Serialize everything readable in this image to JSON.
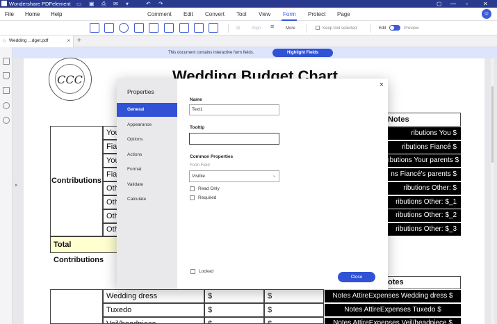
{
  "app": {
    "title": "Wondershare PDFelement"
  },
  "menu": {
    "file": "File",
    "home": "Home",
    "help": "Help",
    "ribbon": [
      "Comment",
      "Edit",
      "Convert",
      "Tool",
      "View",
      "Form",
      "Protect",
      "Page"
    ],
    "active": "Form"
  },
  "toolbar": {
    "align": "Align",
    "more": "More",
    "keep_tool": "Keep tool selected",
    "edit": "Edit",
    "preview": "Preview"
  },
  "tabs": {
    "doc_name": "Wedding ...dget.pdf"
  },
  "notification": {
    "message": "This document contains interactive form fields.",
    "button": "Highlight Fields"
  },
  "document": {
    "title": "Wedding Budget Chart",
    "seal_letters": "CCC",
    "table1": {
      "group_label": "Contributions",
      "notes_header": "Notes",
      "rows": [
        {
          "label": "You",
          "note": "ributions You $"
        },
        {
          "label": "Fianc",
          "note": "ributions Fiancé $"
        },
        {
          "label": "You",
          "note": "ributions Your parents $"
        },
        {
          "label": "Fian",
          "note": "ns Fiancé's parents $"
        },
        {
          "label": "Oth",
          "note": "ributions Other: $"
        },
        {
          "label": "Oth",
          "note": "ributions Other: $_1"
        },
        {
          "label": "Oth",
          "note": "ributions Other: $_2"
        },
        {
          "label": "Oth",
          "note": "ributions Other: $_3"
        }
      ],
      "total_label": "Total Contributions"
    },
    "table2": {
      "notes_header": "otes",
      "rows": [
        {
          "item": "Wedding dress",
          "c1": "$",
          "c2": "$",
          "note": "Notes AttireExpenses Wedding dress $"
        },
        {
          "item": "Tuxedo",
          "c1": "$",
          "c2": "$",
          "note": "Notes AttireExpenses Tuxedo $"
        },
        {
          "item": "Veil/headpiece",
          "c1": "$",
          "c2": "$",
          "note": "Notes AttireExpenses Veil/headpiece $"
        }
      ]
    }
  },
  "dialog": {
    "heading": "Properties",
    "nav": [
      "General",
      "Appearance",
      "Options",
      "Actions",
      "Format",
      "Validate",
      "Calculate"
    ],
    "active_nav": "General",
    "name_label": "Name",
    "name_value": "Text1",
    "tooltip_label": "Tooltip",
    "tooltip_value": "",
    "common_label": "Common  Properties",
    "form_field_label": "Form Field",
    "form_field_value": "Visible",
    "read_only": "Read Only",
    "required": "Required",
    "locked": "Locked",
    "close_button": "Close"
  },
  "colors": {
    "brand": "#2a3b8f",
    "accent": "#3152d4"
  }
}
